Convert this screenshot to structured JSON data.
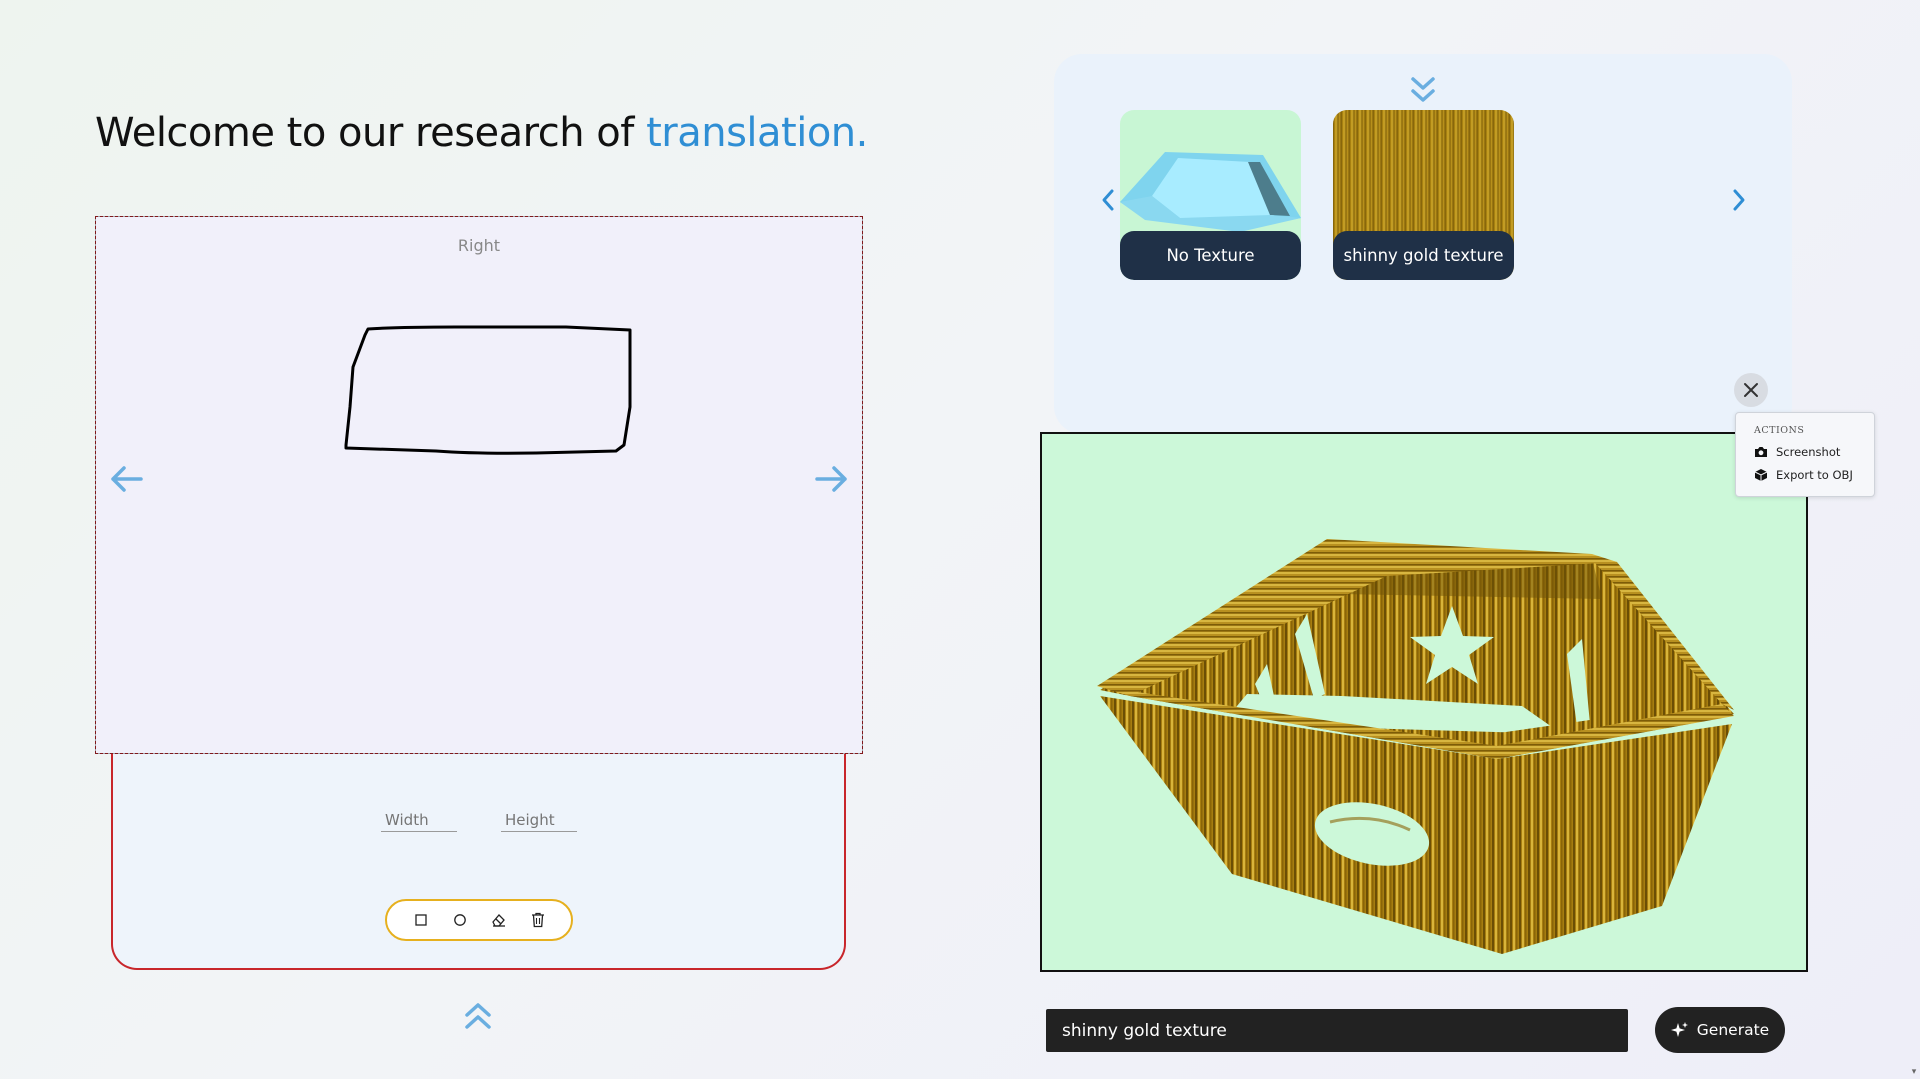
{
  "heading": {
    "prefix": "Welcome to our research of ",
    "accent": "translation."
  },
  "canvas": {
    "view_label": "Right"
  },
  "dimensions": {
    "width_placeholder": "Width",
    "height_placeholder": "Height"
  },
  "toolbar": {
    "tools": [
      "square-tool",
      "circle-tool",
      "eraser-tool",
      "trash-tool"
    ]
  },
  "textures": {
    "items": [
      {
        "label": "No Texture"
      },
      {
        "label": "shinny gold texture"
      }
    ]
  },
  "actions_menu": {
    "title": "ACTIONS",
    "items": [
      {
        "label": "Screenshot",
        "icon": "camera-icon"
      },
      {
        "label": "Export to OBJ",
        "icon": "cube-icon"
      }
    ]
  },
  "prompt": {
    "value": "shinny gold texture"
  },
  "generate": {
    "label": "Generate",
    "icon": "sparkle-icon"
  },
  "colors": {
    "accent": "#2f8ed4",
    "dark": "#222222",
    "panel_border": "#c8262b",
    "toolbar_border": "#e6b01e",
    "viewer_bg": "#ccf8d9"
  }
}
